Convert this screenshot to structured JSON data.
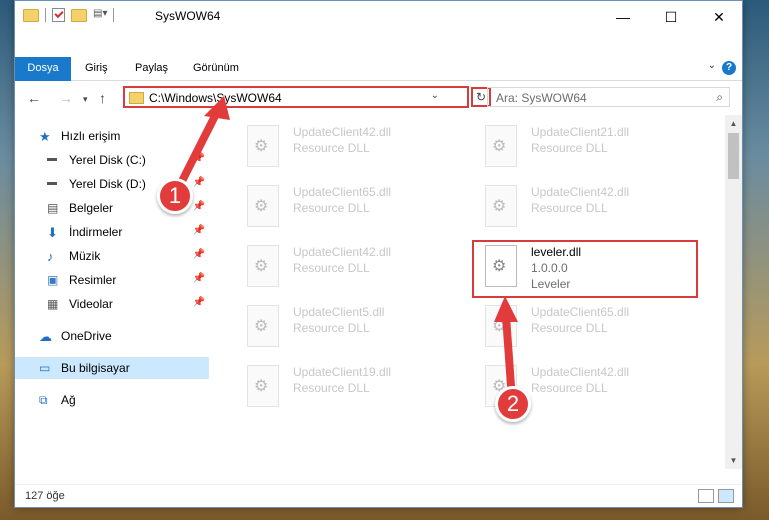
{
  "window": {
    "title": "SysWOW64"
  },
  "window_controls": {
    "minimize": "—",
    "maximize": "☐",
    "close": "✕"
  },
  "ribbon": {
    "tabs": [
      {
        "label": "Dosya"
      },
      {
        "label": "Giriş"
      },
      {
        "label": "Paylaş"
      },
      {
        "label": "Görünüm"
      }
    ],
    "help": "?"
  },
  "address": {
    "path": "C:\\Windows\\SysWOW64",
    "search_placeholder": "Ara: SysWOW64"
  },
  "sidebar": {
    "items": [
      {
        "label": "Hızlı erişim",
        "icon": "star-icon"
      },
      {
        "label": "Yerel Disk (C:)",
        "icon": "drive-icon",
        "pinned": true
      },
      {
        "label": "Yerel Disk (D:)",
        "icon": "drive-icon",
        "pinned": true
      },
      {
        "label": "Belgeler",
        "icon": "documents-icon",
        "pinned": true
      },
      {
        "label": "İndirmeler",
        "icon": "download-icon",
        "pinned": true
      },
      {
        "label": "Müzik",
        "icon": "music-icon",
        "pinned": true
      },
      {
        "label": "Resimler",
        "icon": "pictures-icon",
        "pinned": true
      },
      {
        "label": "Videolar",
        "icon": "videos-icon",
        "pinned": true
      },
      {
        "label": "OneDrive",
        "icon": "cloud-icon"
      },
      {
        "label": "Bu bilgisayar",
        "icon": "computer-icon",
        "selected": true
      },
      {
        "label": "Ağ",
        "icon": "network-icon"
      }
    ]
  },
  "files": [
    {
      "name": "UpdateClient42.dll",
      "type": "Resource DLL"
    },
    {
      "name": "UpdateClient21.dll",
      "type": "Resource DLL"
    },
    {
      "name": "UpdateClient65.dll",
      "type": "Resource DLL"
    },
    {
      "name": "UpdateClient42.dll",
      "type": "Resource DLL"
    },
    {
      "name": "UpdateClient42.dll",
      "type": "Resource DLL"
    },
    {
      "name": "leveler.dll",
      "version": "1.0.0.0",
      "type": "Leveler",
      "highlighted": true
    },
    {
      "name": "UpdateClient5.dll",
      "type": "Resource DLL"
    },
    {
      "name": "UpdateClient65.dll",
      "type": "Resource DLL"
    },
    {
      "name": "UpdateClient19.dll",
      "type": "Resource DLL"
    },
    {
      "name": "UpdateClient42.dll",
      "type": "Resource DLL"
    }
  ],
  "status": {
    "count": "127 öğe"
  },
  "annotations": {
    "step1": "1",
    "step2": "2",
    "color": "#e23b3b"
  }
}
